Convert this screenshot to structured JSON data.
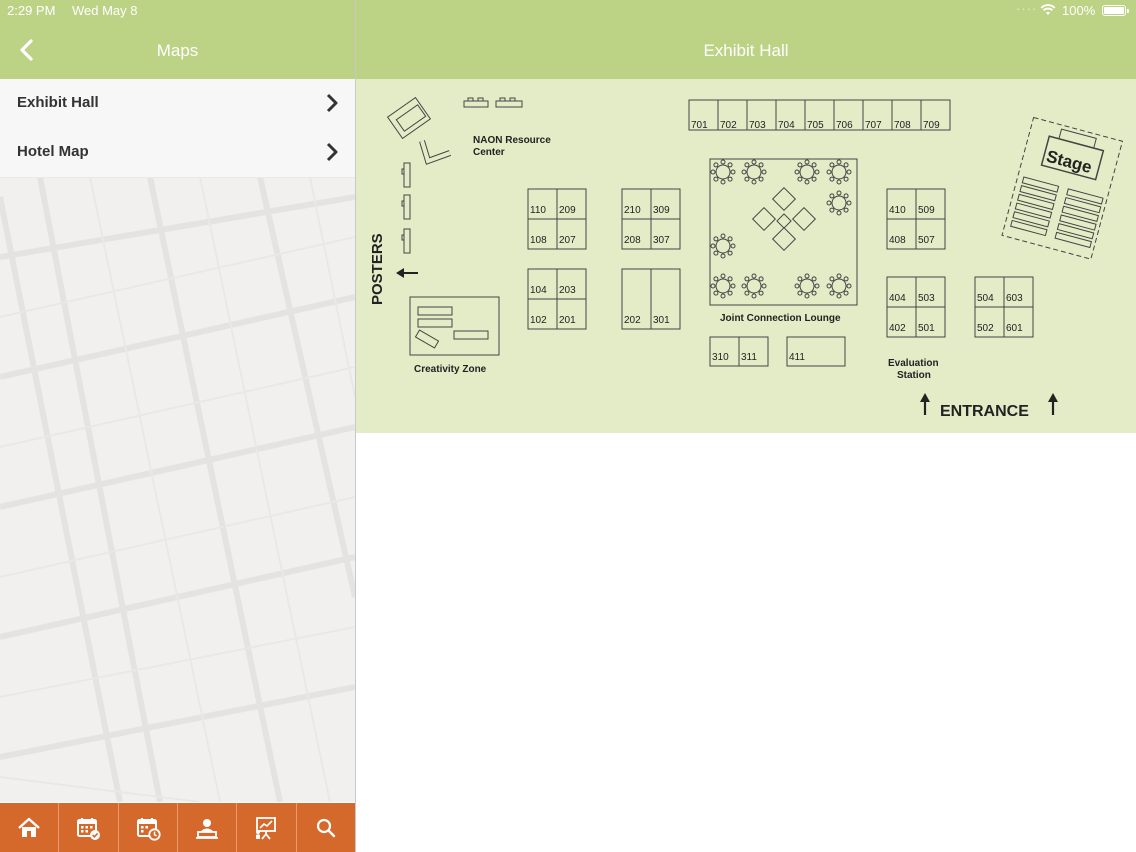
{
  "status_bar": {
    "time": "2:29 PM",
    "date": "Wed May 8",
    "battery": "100%",
    "battery_level": 1.0
  },
  "left_nav": {
    "title": "Maps",
    "back_icon": "chevron-left-icon"
  },
  "right_nav": {
    "title": "Exhibit Hall"
  },
  "sidebar": {
    "items": [
      {
        "label": "Exhibit Hall",
        "icon": "chevron-right-icon"
      },
      {
        "label": "Hotel Map",
        "icon": "chevron-right-icon"
      }
    ]
  },
  "tabbar": {
    "tabs": [
      {
        "icon": "home-icon"
      },
      {
        "icon": "calendar-check-icon"
      },
      {
        "icon": "schedule-icon"
      },
      {
        "icon": "speaker-icon"
      },
      {
        "icon": "presentation-icon"
      },
      {
        "icon": "search-icon"
      }
    ]
  },
  "floor_plan": {
    "top_row_booths": [
      "701",
      "702",
      "703",
      "704",
      "705",
      "706",
      "707",
      "708",
      "709"
    ],
    "block_a": [
      "110",
      "209",
      "108",
      "207"
    ],
    "block_b": [
      "210",
      "309",
      "208",
      "307"
    ],
    "block_c": [
      "104",
      "203",
      "102",
      "201"
    ],
    "block_d": [
      "202",
      "301"
    ],
    "block_e": [
      "410",
      "509",
      "408",
      "507"
    ],
    "block_f": [
      "404",
      "503",
      "402",
      "501"
    ],
    "block_g": [
      "504",
      "603",
      "502",
      "601"
    ],
    "block_h": [
      "310",
      "311"
    ],
    "block_i": [
      "411"
    ],
    "labels": {
      "resource_center_line1": "NAON Resource",
      "resource_center_line2": "Center",
      "posters": "POSTERS",
      "creativity_zone": "Creativity Zone",
      "lounge": "Joint Connection Lounge",
      "evaluation_line1": "Evaluation",
      "evaluation_line2": "Station",
      "entrance": "ENTRANCE",
      "stage": "Stage"
    }
  },
  "colors": {
    "header_green": "#bcd386",
    "map_green": "#e3ecc7",
    "tabbar_orange": "#d4692b"
  }
}
